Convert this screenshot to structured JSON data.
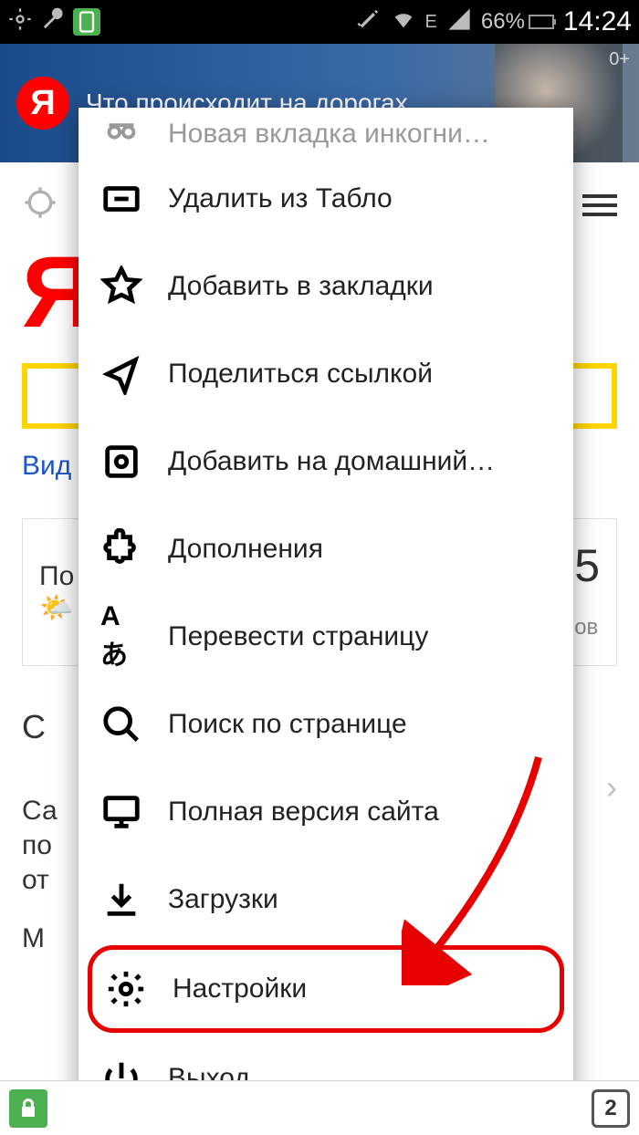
{
  "status": {
    "battery_pct": "66%",
    "time": "14:24",
    "network_label": "E"
  },
  "banner": {
    "text": "Что происходит на дорогах",
    "age_rating": "0+",
    "logo_letter": "Я"
  },
  "page": {
    "logo_letter": "Я",
    "tabs_link": "Вид",
    "weather_label": "По",
    "weather_value": "5",
    "weather_unit": "ов",
    "section_c": "С",
    "section_text1": "Са",
    "section_text2": "по",
    "section_text3": "от",
    "section_m": "М"
  },
  "menu": {
    "items": [
      {
        "label": "Новая вкладка инкогни…",
        "icon": "incognito-icon"
      },
      {
        "label": "Удалить из Табло",
        "icon": "remove-tile-icon"
      },
      {
        "label": "Добавить в закладки",
        "icon": "star-icon"
      },
      {
        "label": "Поделиться ссылкой",
        "icon": "share-icon"
      },
      {
        "label": "Добавить на домашний…",
        "icon": "add-home-icon"
      },
      {
        "label": "Дополнения",
        "icon": "puzzle-icon"
      },
      {
        "label": "Перевести страницу",
        "icon": "translate-icon"
      },
      {
        "label": "Поиск по странице",
        "icon": "search-page-icon"
      },
      {
        "label": "Полная версия сайта",
        "icon": "desktop-icon"
      },
      {
        "label": "Загрузки",
        "icon": "download-icon"
      },
      {
        "label": "Настройки",
        "icon": "settings-icon",
        "highlighted": true
      },
      {
        "label": "Выход",
        "icon": "power-icon"
      }
    ]
  },
  "bottom_bar": {
    "tab_count": "2"
  }
}
